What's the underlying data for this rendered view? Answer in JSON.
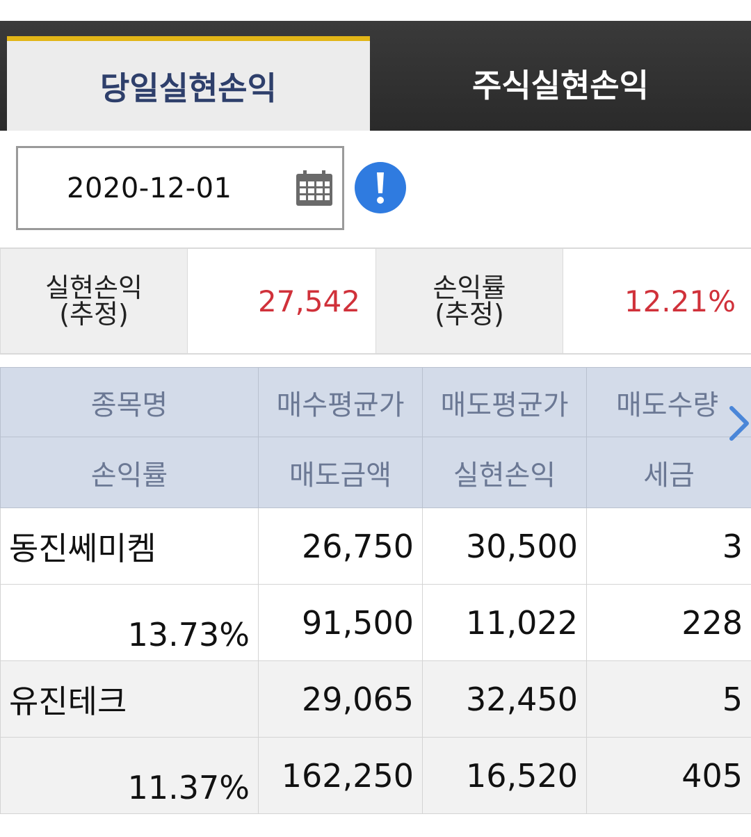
{
  "tabs": [
    {
      "label": "당일실현손익",
      "active": true
    },
    {
      "label": "주식실현손익",
      "active": false
    }
  ],
  "date_picker": {
    "value": "2020-12-01",
    "icon": "calendar-icon"
  },
  "info_button": {
    "icon": "exclamation-icon",
    "color": "#2f7be0"
  },
  "summary": {
    "realized_label_1": "실현손익",
    "realized_label_2": "(추정)",
    "realized_value": "27,542",
    "rate_label_1": "손익률",
    "rate_label_2": "(추정)",
    "rate_value": "12.21%"
  },
  "table": {
    "header_row1": [
      "종목명",
      "매수평균가",
      "매도평균가",
      "매도수량"
    ],
    "header_row2": [
      "손익률",
      "매도금액",
      "실현손익",
      "세금"
    ],
    "stocks": [
      {
        "name": "동진쎄미켐",
        "buy_avg": "26,750",
        "sell_avg": "30,500",
        "qty": "3",
        "rate": "13.73%",
        "sell_amount": "91,500",
        "pnl": "11,022",
        "tax": "228"
      },
      {
        "name": "유진테크",
        "buy_avg": "29,065",
        "sell_avg": "32,450",
        "qty": "5",
        "rate": "11.37%",
        "sell_amount": "162,250",
        "pnl": "16,520",
        "tax": "405"
      }
    ]
  },
  "colors": {
    "accent": "#e2b517",
    "profit": "#cc1f2a",
    "header_bg": "#d3dbe9",
    "tab_dark": "#2e2e2e"
  }
}
